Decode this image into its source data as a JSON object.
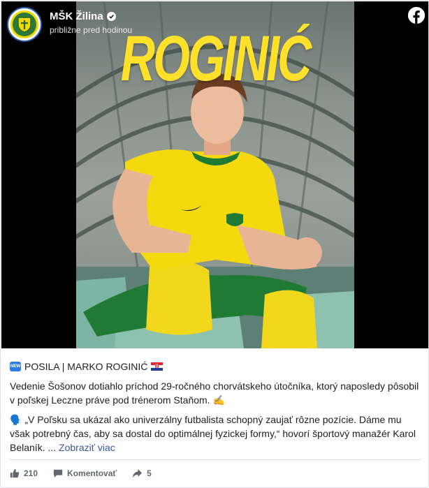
{
  "page": {
    "name": "MŠK Žilina",
    "timestamp": "približne pred hodinou"
  },
  "media": {
    "headline": "ROGINIĆ"
  },
  "post": {
    "badge": "NEW",
    "title": "POSILA | MARKO ROGINIĆ",
    "paragraph1": "Vedenie Šošonov dotiahlo príchod 29-ročného chorvátskeho útočníka, ktorý naposledy pôsobil v poľskej Leczne práve pod trénerom Staňom. ✍️",
    "paragraph2": "🗣️ „V Poľsku sa ukázal ako univerzálny futbalista schopný zaujať rôzne pozície. Dáme mu však potrebný čas, aby sa dostal do optimálnej fyzickej formy,“ hovorí športový manažér Karol Belaník. ...",
    "see_more": "Zobraziť viac"
  },
  "footer": {
    "likes": "210",
    "comment_label": "Komentovať",
    "shares": "5"
  },
  "icons": {
    "verified": "verified-badge-icon",
    "facebook": "facebook-logo-icon",
    "like": "thumbs-up-icon",
    "comment": "comment-icon",
    "share": "share-arrow-icon"
  },
  "colors": {
    "brand_yellow": "#ffe12b",
    "club_green": "#2b7a3a",
    "link": "#385898",
    "muted": "#606770"
  }
}
